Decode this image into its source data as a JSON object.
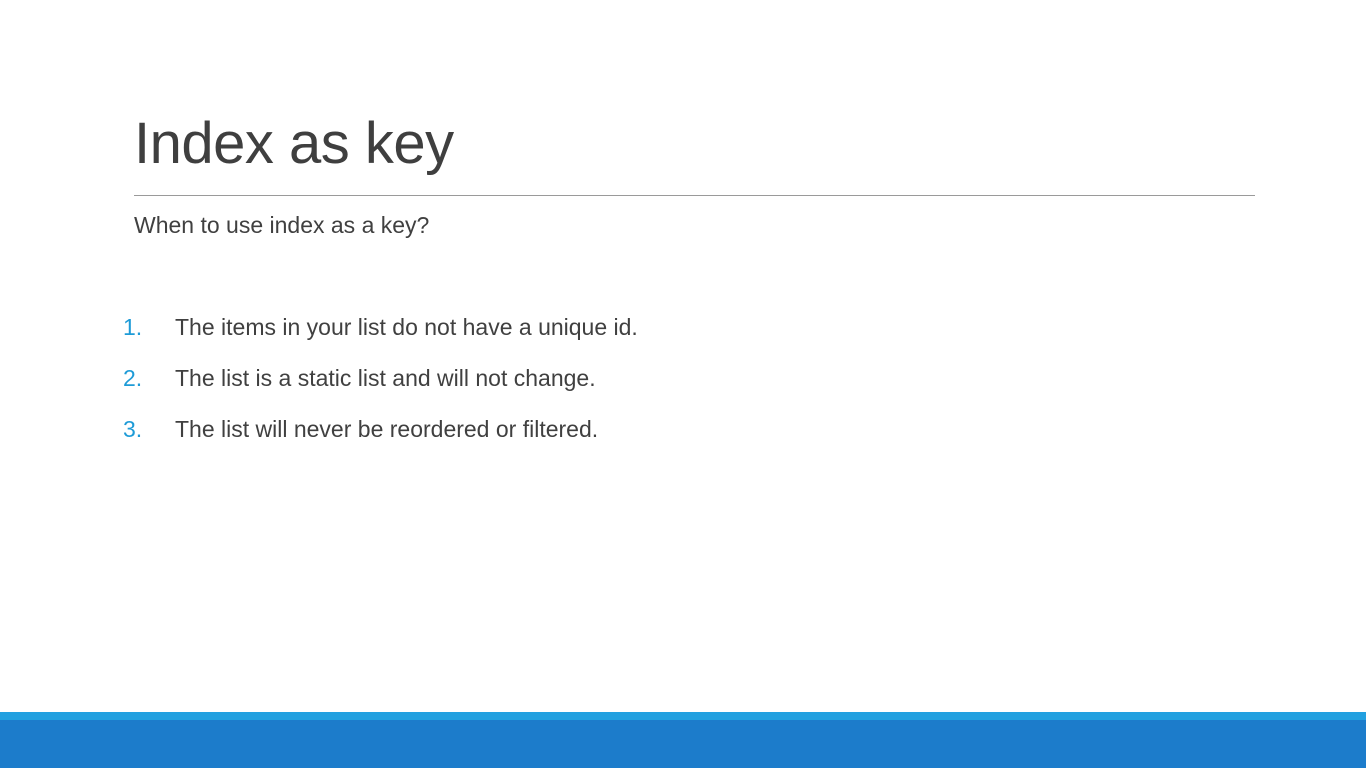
{
  "slide": {
    "title": "Index as key",
    "subtitle": "When to use index as a key?",
    "list": [
      {
        "number": "1.",
        "text": "The items in your list do not have a unique id."
      },
      {
        "number": "2.",
        "text": "The list is a static list and will not change."
      },
      {
        "number": "3.",
        "text": "The list will never be reordered or filtered."
      }
    ]
  },
  "colors": {
    "accent": "#1e9bd7",
    "footer": "#1c7ccb",
    "footer_stripe": "#22a0e0",
    "text": "#404040"
  }
}
